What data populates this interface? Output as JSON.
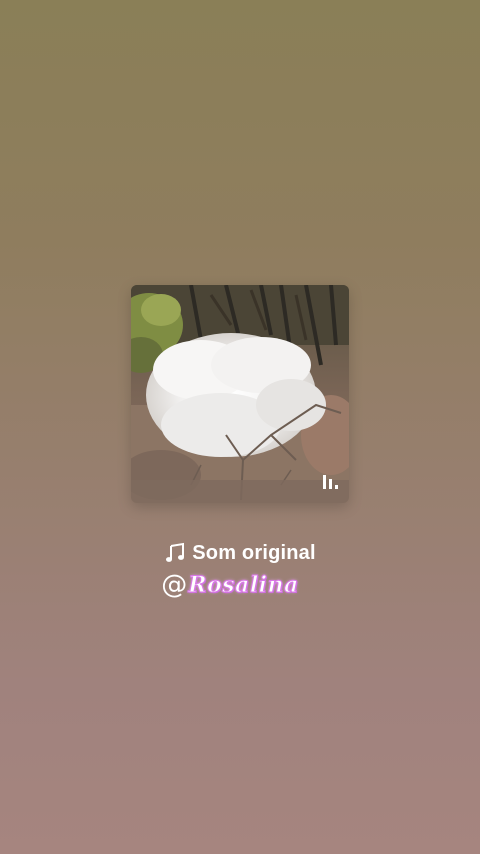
{
  "sound": {
    "title": "Som original",
    "icon": "music-note-icon"
  },
  "author": {
    "at": "@",
    "name": "Rosalina"
  },
  "cover": {
    "description_icon": "flowering-tree-image",
    "audio_indicator_icon": "audio-bars-icon"
  },
  "colors": {
    "background_top": "#8a7f57",
    "background_bottom": "#a6857f",
    "author_glow": "#d977e6",
    "text": "#ffffff"
  }
}
